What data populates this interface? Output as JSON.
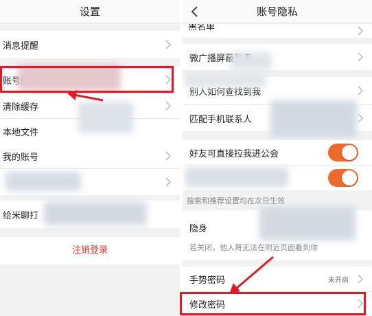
{
  "colors": {
    "accent": "#e11b23",
    "toggle_on": "#ee6a2b",
    "logout": "#e5352b"
  },
  "left": {
    "title": "设置",
    "items": [
      {
        "label": "消息提醒"
      },
      {
        "label": "账号隐私"
      },
      {
        "label": "清除缓存"
      },
      {
        "label": "本地文件"
      },
      {
        "label": "我的账号"
      },
      {
        "label": ""
      },
      {
        "label": "给米聊打"
      }
    ],
    "logout_label": "注销登录"
  },
  "right": {
    "title": "账号隐私",
    "items": {
      "item_top": "黑名单",
      "item_block": "微广播屏蔽列表",
      "item_find": "别人如何查找到我",
      "item_contacts": "匹配手机联系人",
      "toggle_guild": "好友可直接拉我进公会",
      "search_note": "搜索和推荐设置均在次日生效",
      "stealth": "隐身",
      "stealth_note": "若关闭，他人将无法在附近页面看到你",
      "gesture_pwd": "手势密码",
      "gesture_status": "未开启",
      "change_pwd": "修改密码"
    }
  }
}
